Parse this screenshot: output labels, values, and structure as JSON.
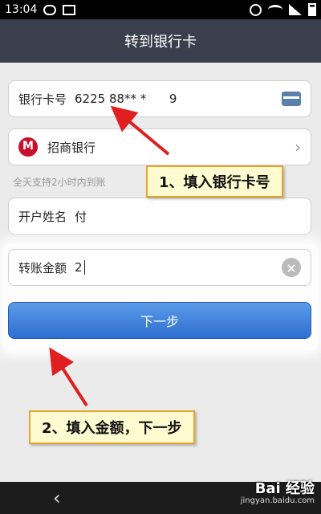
{
  "status": {
    "time": "13:04"
  },
  "title": "转到银行卡",
  "card": {
    "label": "银行卡号",
    "value": "6225 88** *      9"
  },
  "bank": {
    "name": "招商银行"
  },
  "hint": "全天支持2小时内到账",
  "name_field": {
    "label": "开户姓名",
    "value": "付"
  },
  "amount": {
    "label": "转账金额",
    "value": "2"
  },
  "next_button": "下一步",
  "callouts": {
    "step1": "1、填入银行卡号",
    "step2": "2、填入金额，下一步"
  },
  "watermark": {
    "brand": "Bai 经验",
    "url": "jingyan.baidu.com"
  },
  "colors": {
    "arrow": "#e02020",
    "button": "#2f6fd1",
    "callout_bg": "#fffbd1"
  }
}
